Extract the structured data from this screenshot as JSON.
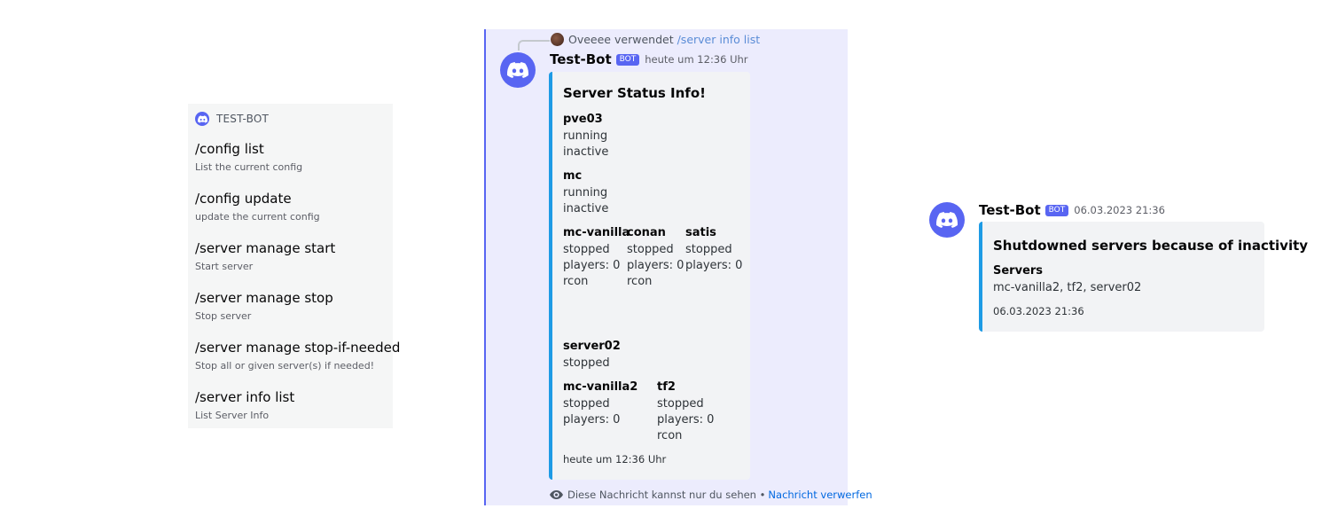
{
  "command_list": {
    "bot_name": "TEST-BOT",
    "commands": [
      {
        "name": "/config list",
        "description": "List the current config"
      },
      {
        "name": "/config update",
        "description": "update the current config"
      },
      {
        "name": "/server manage start",
        "description": "Start server"
      },
      {
        "name": "/server manage stop",
        "description": "Stop server"
      },
      {
        "name": "/server manage stop-if-needed",
        "description": "Stop all or given server(s) if needed!"
      },
      {
        "name": "/server info list",
        "description": "List Server Info"
      }
    ]
  },
  "status_message": {
    "reply": {
      "user": "Oveeee",
      "action": "verwendet",
      "command": "/server info list"
    },
    "author": "Test-Bot",
    "badge": "BOT",
    "timestamp": "heute um 12:36 Uhr",
    "embed": {
      "accent_color": "#1e9be5",
      "title": "Server Status Info!",
      "fields": [
        {
          "name": "pve03",
          "value": "running\ninactive"
        },
        {
          "name": "mc",
          "value": "running\ninactive"
        },
        {
          "name": "mc-vanilla",
          "value": "stopped\nplayers: 0\nrcon"
        },
        {
          "name": "conan",
          "value": "stopped\nplayers: 0\nrcon"
        },
        {
          "name": "satis",
          "value": "stopped\nplayers: 0"
        },
        {
          "name": "server02",
          "value": "stopped"
        },
        {
          "name": "mc-vanilla2",
          "value": "stopped\nplayers: 0"
        },
        {
          "name": "tf2",
          "value": "stopped\nplayers: 0\nrcon"
        }
      ],
      "footer": "heute um 12:36 Uhr"
    },
    "ephemeral_notice": "Diese Nachricht kannst nur du sehen •",
    "dismiss_link": "Nachricht verwerfen"
  },
  "shutdown_message": {
    "author": "Test-Bot",
    "badge": "BOT",
    "timestamp": "06.03.2023 21:36",
    "embed": {
      "accent_color": "#1e9be5",
      "title": "Shutdowned servers because of inactivity",
      "field_name": "Servers",
      "field_value": "mc-vanilla2, tf2, server02",
      "footer": "06.03.2023 21:36"
    }
  },
  "colors": {
    "blurple": "#5865f2",
    "ephemeral_bg": "#ececfd",
    "link": "#0068e0"
  },
  "icons": [
    "discord-icon",
    "eye-icon"
  ]
}
